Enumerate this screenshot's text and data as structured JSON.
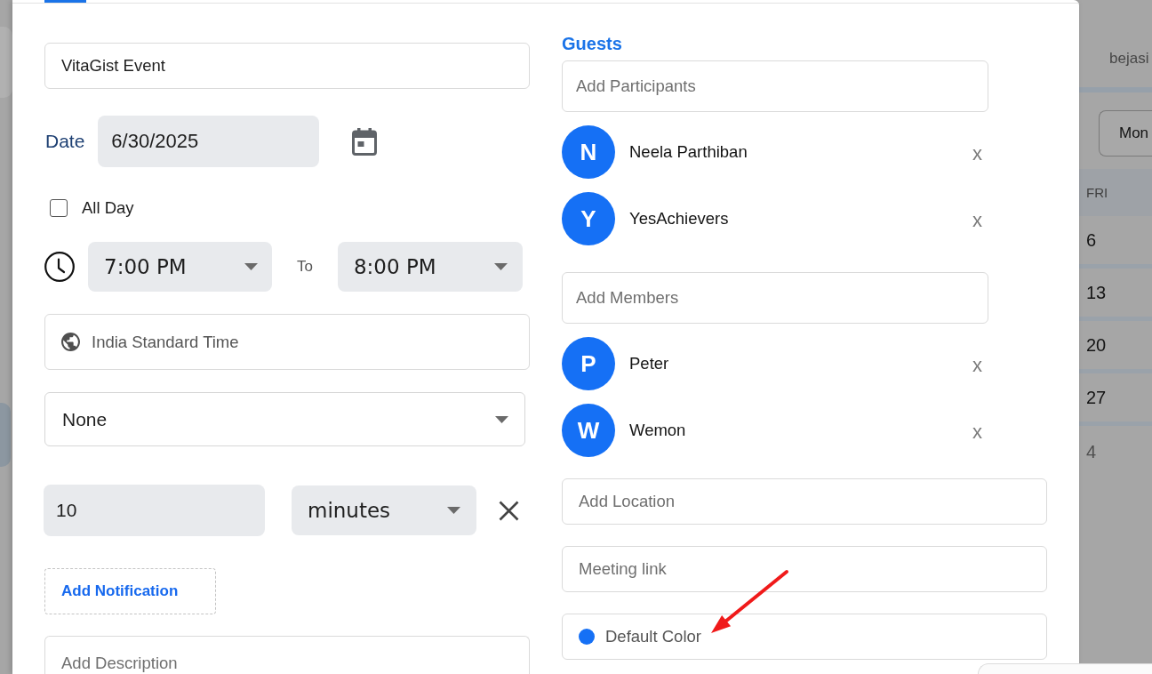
{
  "dialog": {
    "tabs": [
      {
        "selected": true
      }
    ],
    "title_field": {
      "value": "VitaGist Event"
    },
    "date": {
      "label": "Date",
      "value": "6/30/2025"
    },
    "all_day": {
      "label": "All Day",
      "checked": false
    },
    "time": {
      "start": "7:00 PM",
      "separator": "To",
      "end": "8:00 PM"
    },
    "timezone": {
      "value": "India Standard Time"
    },
    "repeat": {
      "value": "None"
    },
    "notifications": [
      {
        "amount": "10",
        "unit": "minutes"
      }
    ],
    "add_notification": "Add Notification",
    "description": {
      "placeholder": "Add Description"
    },
    "guests": {
      "heading": "Guests",
      "participants_field": {
        "placeholder": "Add Participants"
      },
      "participants": [
        {
          "initial": "N",
          "name": "Neela Parthiban",
          "remove": "x"
        },
        {
          "initial": "Y",
          "name": "YesAchievers",
          "remove": "x"
        }
      ],
      "members_field": {
        "placeholder": "Add Members"
      },
      "members": [
        {
          "initial": "P",
          "name": "Peter",
          "remove": "x"
        },
        {
          "initial": "W",
          "name": "Wemon",
          "remove": "x"
        }
      ]
    },
    "location": {
      "placeholder": "Add Location"
    },
    "meeting_link": {
      "placeholder": "Meeting link"
    },
    "color_field": {
      "label": "Default Color",
      "color": "#1570f5"
    }
  },
  "background": {
    "user_name": "bejasi",
    "view_button": "Mon",
    "calendar": {
      "column_header": "FRI",
      "days": [
        {
          "day": "6",
          "muted": false
        },
        {
          "day": "13",
          "muted": false
        },
        {
          "day": "20",
          "muted": false
        },
        {
          "day": "27",
          "muted": false
        },
        {
          "day": "4",
          "muted": true
        }
      ]
    }
  }
}
